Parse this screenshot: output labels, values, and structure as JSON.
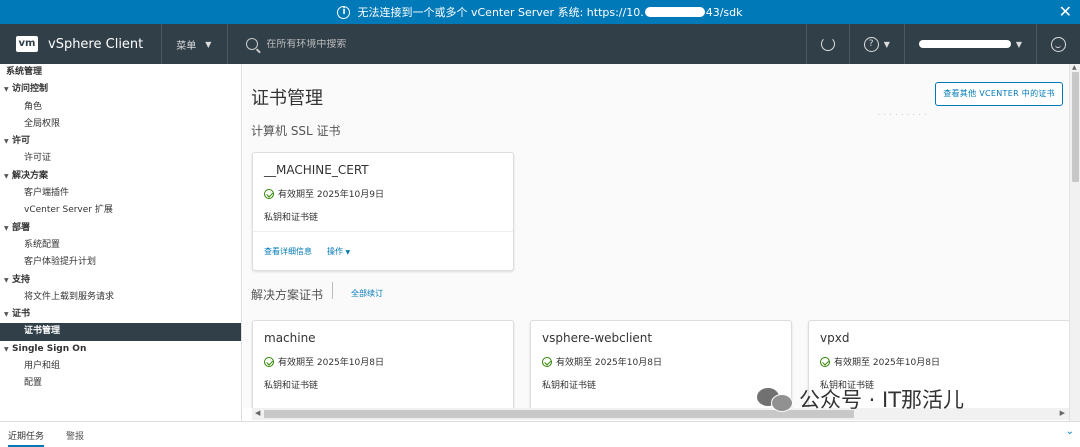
{
  "alert": {
    "prefix": "无法连接到一个或多个 vCenter Server 系统: https://10.",
    "suffix": "43/sdk"
  },
  "header": {
    "logo": "vm",
    "app_title": "vSphere Client",
    "menu_label": "菜单",
    "search_placeholder": "在所有环境中搜索"
  },
  "sidebar": {
    "root": "系统管理",
    "groups": [
      {
        "label": "访问控制",
        "items": [
          "角色",
          "全局权限"
        ]
      },
      {
        "label": "许可",
        "items": [
          "许可证"
        ]
      },
      {
        "label": "解决方案",
        "items": [
          "客户端插件",
          "vCenter Server 扩展"
        ]
      },
      {
        "label": "部署",
        "items": [
          "系统配置",
          "客户体验提升计划"
        ]
      },
      {
        "label": "支持",
        "items": [
          "将文件上载到服务请求"
        ]
      },
      {
        "label": "证书",
        "items": [
          "证书管理"
        ]
      },
      {
        "label": "Single Sign On",
        "items": [
          "用户和组",
          "配置"
        ]
      }
    ],
    "active_item": "证书管理"
  },
  "main": {
    "title": "证书管理",
    "view_other_button": "查看其他 VCENTER 中的证书",
    "machine_section_title": "计算机 SSL 证书",
    "machine_card": {
      "title": "__MACHINE_CERT",
      "valid": "有效期至 2025年10月9日",
      "chain": "私钥和证书链",
      "details_link": "查看详细信息",
      "actions_link": "操作"
    },
    "solution_section_title": "解决方案证书",
    "renew_all_link": "全部续订",
    "solution_cards": [
      {
        "title": "machine",
        "valid": "有效期至 2025年10月8日",
        "chain": "私钥和证书链"
      },
      {
        "title": "vsphere-webclient",
        "valid": "有效期至 2025年10月8日",
        "chain": "私钥和证书链"
      },
      {
        "title": "vpxd",
        "valid": "有效期至 2025年10月8日",
        "chain": "私钥和证书链"
      }
    ]
  },
  "bottom": {
    "recent_tasks_tab": "近期任务",
    "alarms_tab": "警报"
  },
  "watermark": "公众号 · IT那活儿",
  "colors": {
    "banner": "#0079b8",
    "header": "#313f48",
    "active_sidebar": "#313f48",
    "link": "#0079b8",
    "valid_check": "#2f8400"
  }
}
